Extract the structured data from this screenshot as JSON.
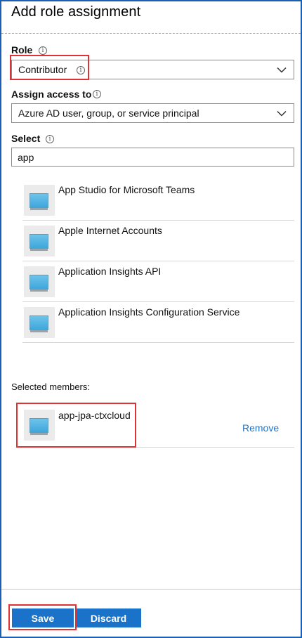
{
  "header": {
    "title": "Add role assignment"
  },
  "role": {
    "label": "Role",
    "value": "Contributor"
  },
  "assign": {
    "label": "Assign access to",
    "value": "Azure AD user, group, or service principal"
  },
  "select": {
    "label": "Select",
    "query": "app"
  },
  "results": [
    {
      "name": "App Studio for Microsoft Teams"
    },
    {
      "name": "Apple Internet Accounts"
    },
    {
      "name": "Application Insights API"
    },
    {
      "name": "Application Insights Configuration Service"
    }
  ],
  "selected": {
    "label": "Selected members:",
    "member": {
      "name": "app-jpa-ctxcloud",
      "remove_label": "Remove"
    }
  },
  "footer": {
    "save_label": "Save",
    "discard_label": "Discard"
  },
  "colors": {
    "accent": "#1a73c8",
    "highlight": "#e03232",
    "frame": "#1a5fb4"
  },
  "icons": {
    "info": "info-icon",
    "chevron": "chevron-down-icon",
    "app": "app-registration-icon"
  }
}
